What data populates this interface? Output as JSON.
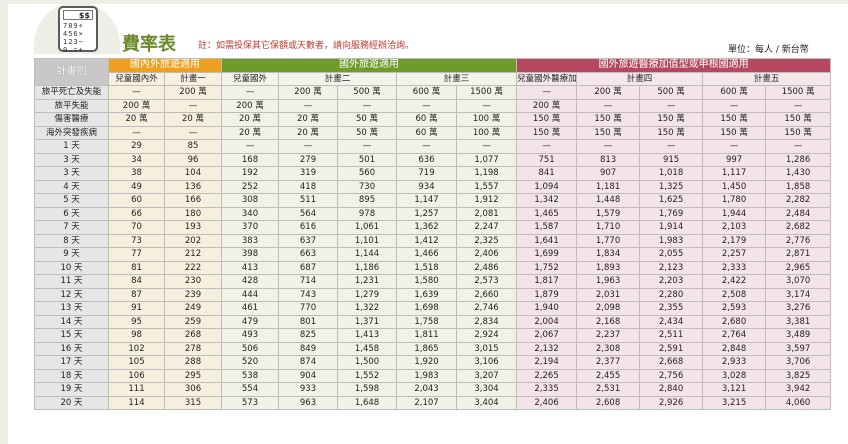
{
  "header": {
    "title": "費率表",
    "note": "註：如需投保其它保額或天數者，請向服務經辦洽詢。",
    "unit": "單位：每人 / 新台幣",
    "calculator_display": "$$",
    "calculator_keys": "789÷\n456×\n123−\n0.=+"
  },
  "table": {
    "plan_label": "計畫別",
    "groups": [
      "國內外旅遊適用",
      "國外旅遊適用",
      "國外旅遊醫療加值型或申根國適用"
    ],
    "subheaders": [
      "兒童國內外",
      "計畫一",
      "兒童國外",
      "計畫二",
      "計畫三",
      "兒童國外醫療加值或申根",
      "計畫四",
      "計畫五"
    ],
    "coverage_rows": [
      {
        "label": "旅平死亡及失能",
        "cells": [
          "—",
          "200 萬",
          "—",
          "200 萬",
          "500 萬",
          "600 萬",
          "1500 萬",
          "—",
          "200 萬",
          "500 萬",
          "600 萬",
          "1500 萬"
        ]
      },
      {
        "label": "旅平失能",
        "cells": [
          "200 萬",
          "—",
          "200 萬",
          "—",
          "—",
          "—",
          "—",
          "200 萬",
          "—",
          "—",
          "—",
          "—"
        ]
      },
      {
        "label": "傷害醫療",
        "cells": [
          "20 萬",
          "20 萬",
          "20 萬",
          "20 萬",
          "50 萬",
          "60 萬",
          "100 萬",
          "150 萬",
          "150 萬",
          "150 萬",
          "150 萬",
          "150 萬"
        ]
      },
      {
        "label": "海外突發疾病",
        "cells": [
          "—",
          "—",
          "20 萬",
          "20 萬",
          "50 萬",
          "60 萬",
          "100 萬",
          "150 萬",
          "150 萬",
          "150 萬",
          "150 萬",
          "150 萬"
        ]
      }
    ],
    "day_rows": [
      {
        "label": "1 天",
        "cells": [
          "29",
          "85",
          "—",
          "—",
          "—",
          "—",
          "—",
          "—",
          "—",
          "—",
          "—",
          "—"
        ]
      },
      {
        "label": "3 天",
        "cells": [
          "34",
          "96",
          "168",
          "279",
          "501",
          "636",
          "1,077",
          "751",
          "813",
          "915",
          "997",
          "1,286"
        ]
      },
      {
        "label": "3 天",
        "cells": [
          "38",
          "104",
          "192",
          "319",
          "560",
          "719",
          "1,198",
          "841",
          "907",
          "1,018",
          "1,117",
          "1,430"
        ]
      },
      {
        "label": "4 天",
        "cells": [
          "49",
          "136",
          "252",
          "418",
          "730",
          "934",
          "1,557",
          "1,094",
          "1,181",
          "1,325",
          "1,450",
          "1,858"
        ]
      },
      {
        "label": "5 天",
        "cells": [
          "60",
          "166",
          "308",
          "511",
          "895",
          "1,147",
          "1,912",
          "1,342",
          "1,448",
          "1,625",
          "1,780",
          "2,282"
        ]
      },
      {
        "label": "6 天",
        "cells": [
          "66",
          "180",
          "340",
          "564",
          "978",
          "1,257",
          "2,081",
          "1,465",
          "1,579",
          "1,769",
          "1,944",
          "2,484"
        ]
      },
      {
        "label": "7 天",
        "cells": [
          "70",
          "193",
          "370",
          "616",
          "1,061",
          "1,362",
          "2,247",
          "1,587",
          "1,710",
          "1,914",
          "2,103",
          "2,682"
        ]
      },
      {
        "label": "8 天",
        "cells": [
          "73",
          "202",
          "383",
          "637",
          "1,101",
          "1,412",
          "2,325",
          "1,641",
          "1,770",
          "1,983",
          "2,179",
          "2,776"
        ]
      },
      {
        "label": "9 天",
        "cells": [
          "77",
          "212",
          "398",
          "663",
          "1,144",
          "1,466",
          "2,406",
          "1,699",
          "1,834",
          "2,055",
          "2,257",
          "2,871"
        ]
      },
      {
        "label": "10 天",
        "cells": [
          "81",
          "222",
          "413",
          "687",
          "1,186",
          "1,518",
          "2,486",
          "1,752",
          "1,893",
          "2,123",
          "2,333",
          "2,965"
        ]
      },
      {
        "label": "11 天",
        "cells": [
          "84",
          "230",
          "428",
          "714",
          "1,231",
          "1,580",
          "2,573",
          "1,817",
          "1,963",
          "2,203",
          "2,422",
          "3,070"
        ]
      },
      {
        "label": "12 天",
        "cells": [
          "87",
          "239",
          "444",
          "743",
          "1,279",
          "1,639",
          "2,660",
          "1,879",
          "2,031",
          "2,280",
          "2,508",
          "3,174"
        ]
      },
      {
        "label": "13 天",
        "cells": [
          "91",
          "249",
          "461",
          "770",
          "1,322",
          "1,698",
          "2,746",
          "1,940",
          "2,098",
          "2,355",
          "2,593",
          "3,276"
        ]
      },
      {
        "label": "14 天",
        "cells": [
          "95",
          "259",
          "479",
          "801",
          "1,371",
          "1,758",
          "2,834",
          "2,004",
          "2,168",
          "2,434",
          "2,680",
          "3,381"
        ]
      },
      {
        "label": "15 天",
        "cells": [
          "98",
          "268",
          "493",
          "825",
          "1,413",
          "1,811",
          "2,924",
          "2,067",
          "2,237",
          "2,511",
          "2,764",
          "3,489"
        ]
      },
      {
        "label": "16 天",
        "cells": [
          "102",
          "278",
          "506",
          "849",
          "1,458",
          "1,865",
          "3,015",
          "2,132",
          "2,308",
          "2,591",
          "2,848",
          "3,597"
        ]
      },
      {
        "label": "17 天",
        "cells": [
          "105",
          "288",
          "520",
          "874",
          "1,500",
          "1,920",
          "3,106",
          "2,194",
          "2,377",
          "2,668",
          "2,933",
          "3,706"
        ]
      },
      {
        "label": "18 天",
        "cells": [
          "106",
          "295",
          "538",
          "904",
          "1,552",
          "1,983",
          "3,207",
          "2,265",
          "2,455",
          "2,756",
          "3,028",
          "3,825"
        ]
      },
      {
        "label": "19 天",
        "cells": [
          "111",
          "306",
          "554",
          "933",
          "1,598",
          "2,043",
          "3,304",
          "2,335",
          "2,531",
          "2,840",
          "3,121",
          "3,942"
        ]
      },
      {
        "label": "20 天",
        "cells": [
          "114",
          "315",
          "573",
          "963",
          "1,648",
          "2,107",
          "3,404",
          "2,406",
          "2,608",
          "2,926",
          "3,215",
          "4,060"
        ]
      }
    ]
  }
}
